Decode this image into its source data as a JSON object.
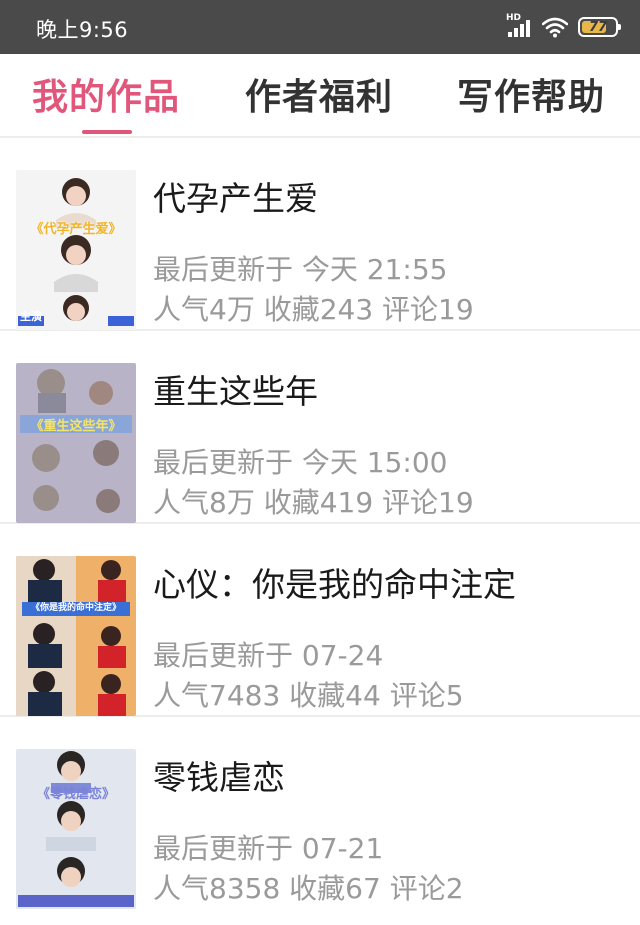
{
  "status_bar": {
    "time": "晚上9:56",
    "signal_badge": "HD",
    "battery": "77",
    "battery_level": 0.77
  },
  "tabs": [
    {
      "label": "我的作品",
      "active": true
    },
    {
      "label": "作者福利",
      "active": false
    },
    {
      "label": "写作帮助",
      "active": false
    }
  ],
  "works": [
    {
      "title": "代孕产生爱",
      "updated": "最后更新于 今天 21:55",
      "stats": "人气4万 收藏243 评论19",
      "cover": {
        "title": "《代孕产生爱》",
        "tag_left": "主演",
        "tag_right": "",
        "bg": "#f3f3f3",
        "accent": "#e8b530"
      }
    },
    {
      "title": "重生这些年",
      "updated": "最后更新于 今天 15:00",
      "stats": "人气8万 收藏419 评论19",
      "cover": {
        "title": "《重生这些年》",
        "tag_left": "",
        "tag_right": "",
        "bg": "#b8b2c6",
        "accent": "#f1e36a"
      }
    },
    {
      "title": "心仪：你是我的命中注定",
      "updated": "最后更新于 07-24",
      "stats": "人气7483 收藏44 评论5",
      "cover": {
        "title": "《你是我的命中注定》",
        "tag_left": "",
        "tag_right": "",
        "bg": "#efb06a",
        "accent": "#3a6fd6"
      }
    },
    {
      "title": "零钱虐恋",
      "updated": "最后更新于 07-21",
      "stats": "人气8358 收藏67 评论2",
      "cover": {
        "title": "《零钱虐恋》",
        "tag_left": "",
        "tag_right": "",
        "bg": "#dfe4ec",
        "accent": "#7a83d8"
      }
    }
  ]
}
